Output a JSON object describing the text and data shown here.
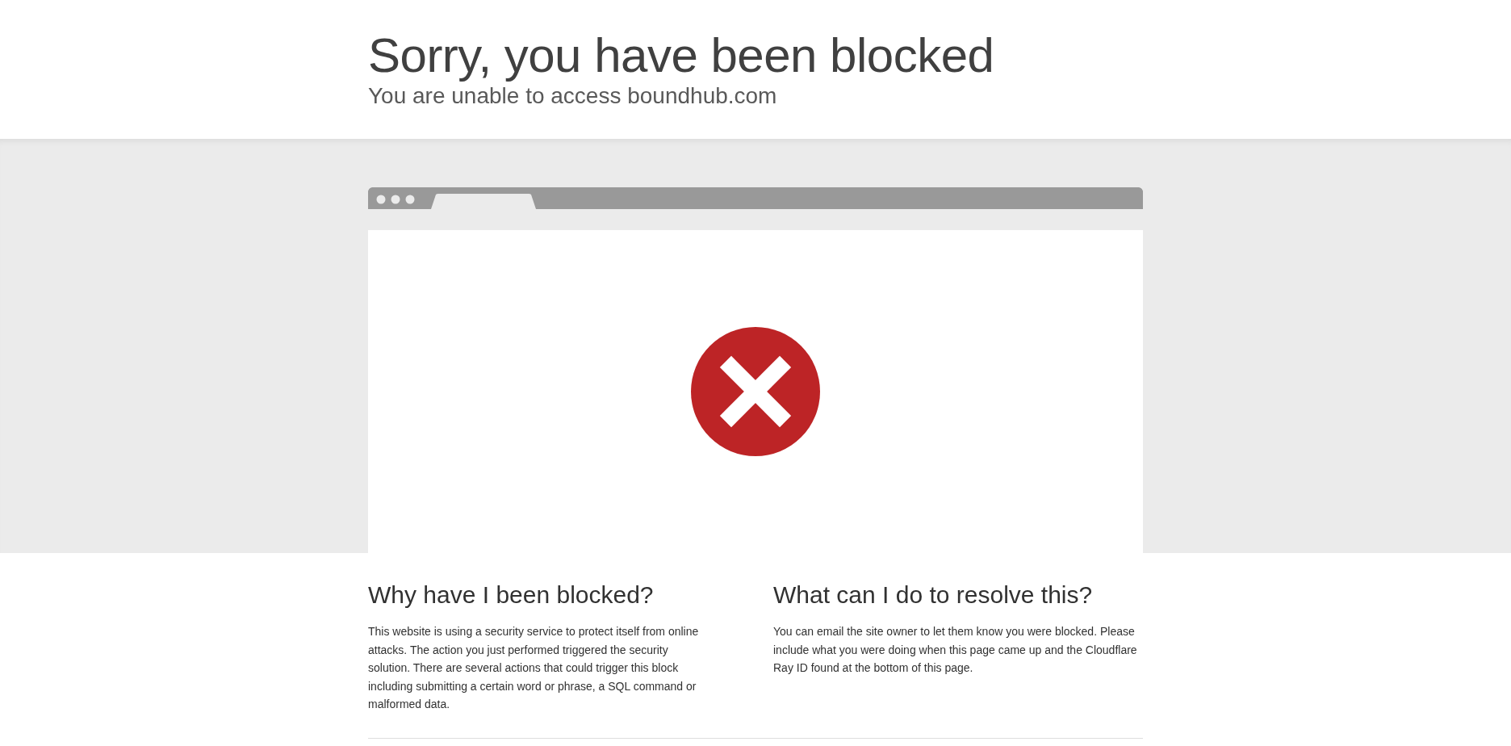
{
  "header": {
    "title": "Sorry, you have been blocked",
    "subtitle": "You are unable to access boundhub.com"
  },
  "sections": [
    {
      "heading": "Why have I been blocked?",
      "text": "This website is using a security service to protect itself from online attacks. The action you just performed triggered the security solution. There are several actions that could trigger this block including submitting a certain word or phrase, a SQL command or malformed data."
    },
    {
      "heading": "What can I do to resolve this?",
      "text": "You can email the site owner to let them know you were blocked. Please include what you were doing when this page came up and the Cloudflare Ray ID found at the bottom of this page."
    }
  ]
}
